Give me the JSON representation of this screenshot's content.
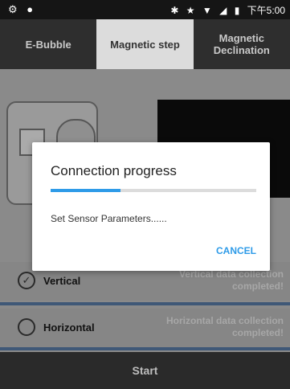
{
  "status_bar": {
    "left_icons": [
      "settings-icon",
      "location-pin-icon"
    ],
    "right_icons": [
      "bluetooth-icon",
      "star-icon",
      "signal-icon",
      "no-signal-icon",
      "battery-icon"
    ],
    "time": "下午5:00"
  },
  "tabs": [
    {
      "label": "E-Bubble",
      "active": false
    },
    {
      "label": "Magnetic step",
      "active": true
    },
    {
      "label": "Magnetic Declination",
      "active": false
    }
  ],
  "rows": [
    {
      "label": "Vertical",
      "checked": true,
      "status": "Vertical data collection completed!"
    },
    {
      "label": "Horizontal",
      "checked": false,
      "status": "Horizontal data collection completed!"
    }
  ],
  "start_label": "Start",
  "dialog": {
    "title": "Connection progress",
    "progress": 0.34,
    "message": "Set Sensor Parameters......",
    "cancel_label": "CANCEL",
    "accent_color": "#2e9be8"
  }
}
